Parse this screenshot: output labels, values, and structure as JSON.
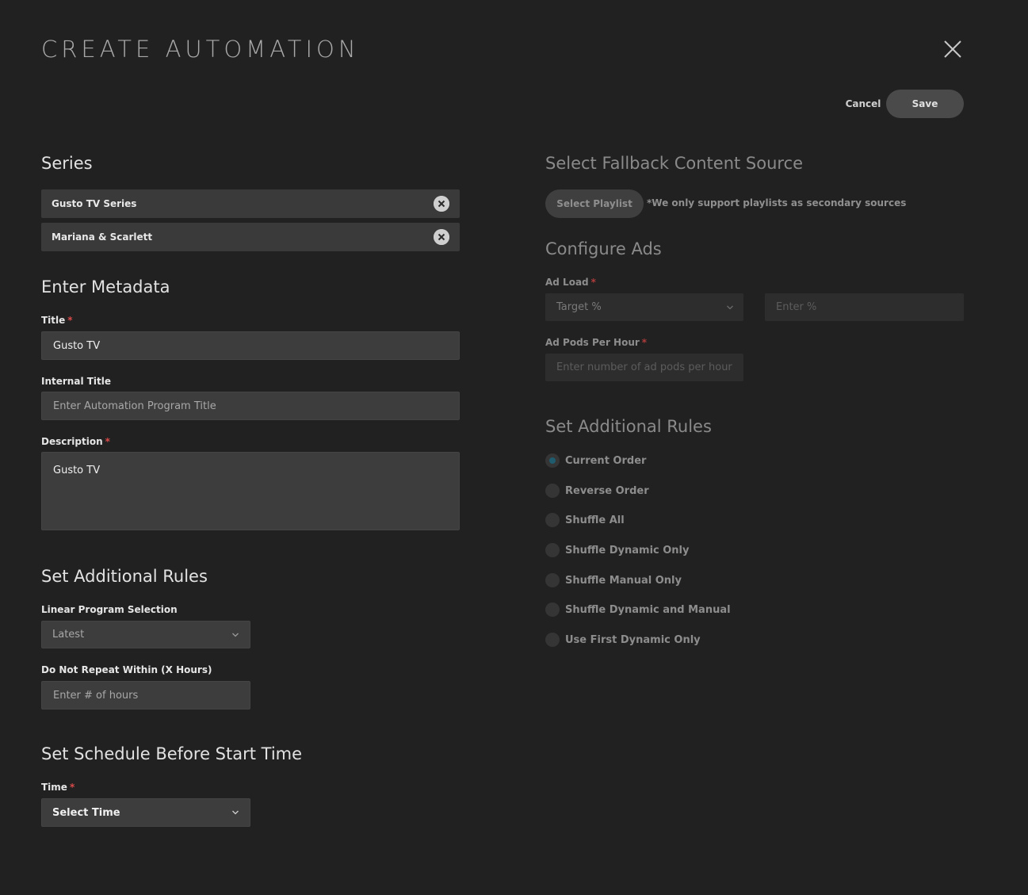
{
  "header": {
    "title": "CREATE AUTOMATION",
    "cancel_label": "Cancel",
    "save_label": "Save"
  },
  "series": {
    "heading": "Series",
    "items": [
      {
        "label": "Gusto TV Series"
      },
      {
        "label": "Mariana & Scarlett"
      }
    ]
  },
  "metadata": {
    "heading": "Enter Metadata",
    "title_label": "Title",
    "title_value": "Gusto TV",
    "internal_title_label": "Internal Title",
    "internal_title_placeholder": "Enter Automation Program Title",
    "description_label": "Description",
    "description_value": "Gusto TV",
    "required_mark": "*"
  },
  "rules_left": {
    "heading": "Set Additional Rules",
    "linear_selection_label": "Linear Program Selection",
    "linear_selection_value": "Latest",
    "do_not_repeat_label": "Do Not Repeat Within (X Hours)",
    "do_not_repeat_placeholder": "Enter # of hours"
  },
  "schedule": {
    "heading": "Set Schedule Before Start Time",
    "time_label": "Time",
    "time_value": "Select Time"
  },
  "fallback": {
    "heading": "Select Fallback Content Source",
    "button_label": "Select Playlist",
    "note": "*We only support playlists as secondary sources"
  },
  "ads": {
    "heading": "Configure Ads",
    "ad_load_label": "Ad Load",
    "ad_load_select": "Target %",
    "ad_load_placeholder": "Enter %",
    "ad_pods_label": "Ad Pods Per Hour",
    "ad_pods_placeholder": "Enter number of ad pods per hour"
  },
  "rules_right": {
    "heading": "Set Additional Rules",
    "options": [
      {
        "label": "Current Order",
        "checked": true
      },
      {
        "label": "Reverse Order",
        "checked": false
      },
      {
        "label": "Shuffle All",
        "checked": false
      },
      {
        "label": "Shuffle Dynamic Only",
        "checked": false
      },
      {
        "label": "Shuffle Manual Only",
        "checked": false
      },
      {
        "label": "Shuffle Dynamic and Manual",
        "checked": false
      },
      {
        "label": "Use First Dynamic Only",
        "checked": false
      }
    ]
  },
  "colors": {
    "background": "#212121",
    "field": "#3d3d3d",
    "required": "#d94a4a",
    "radio_selected": "#1f5c6e"
  }
}
